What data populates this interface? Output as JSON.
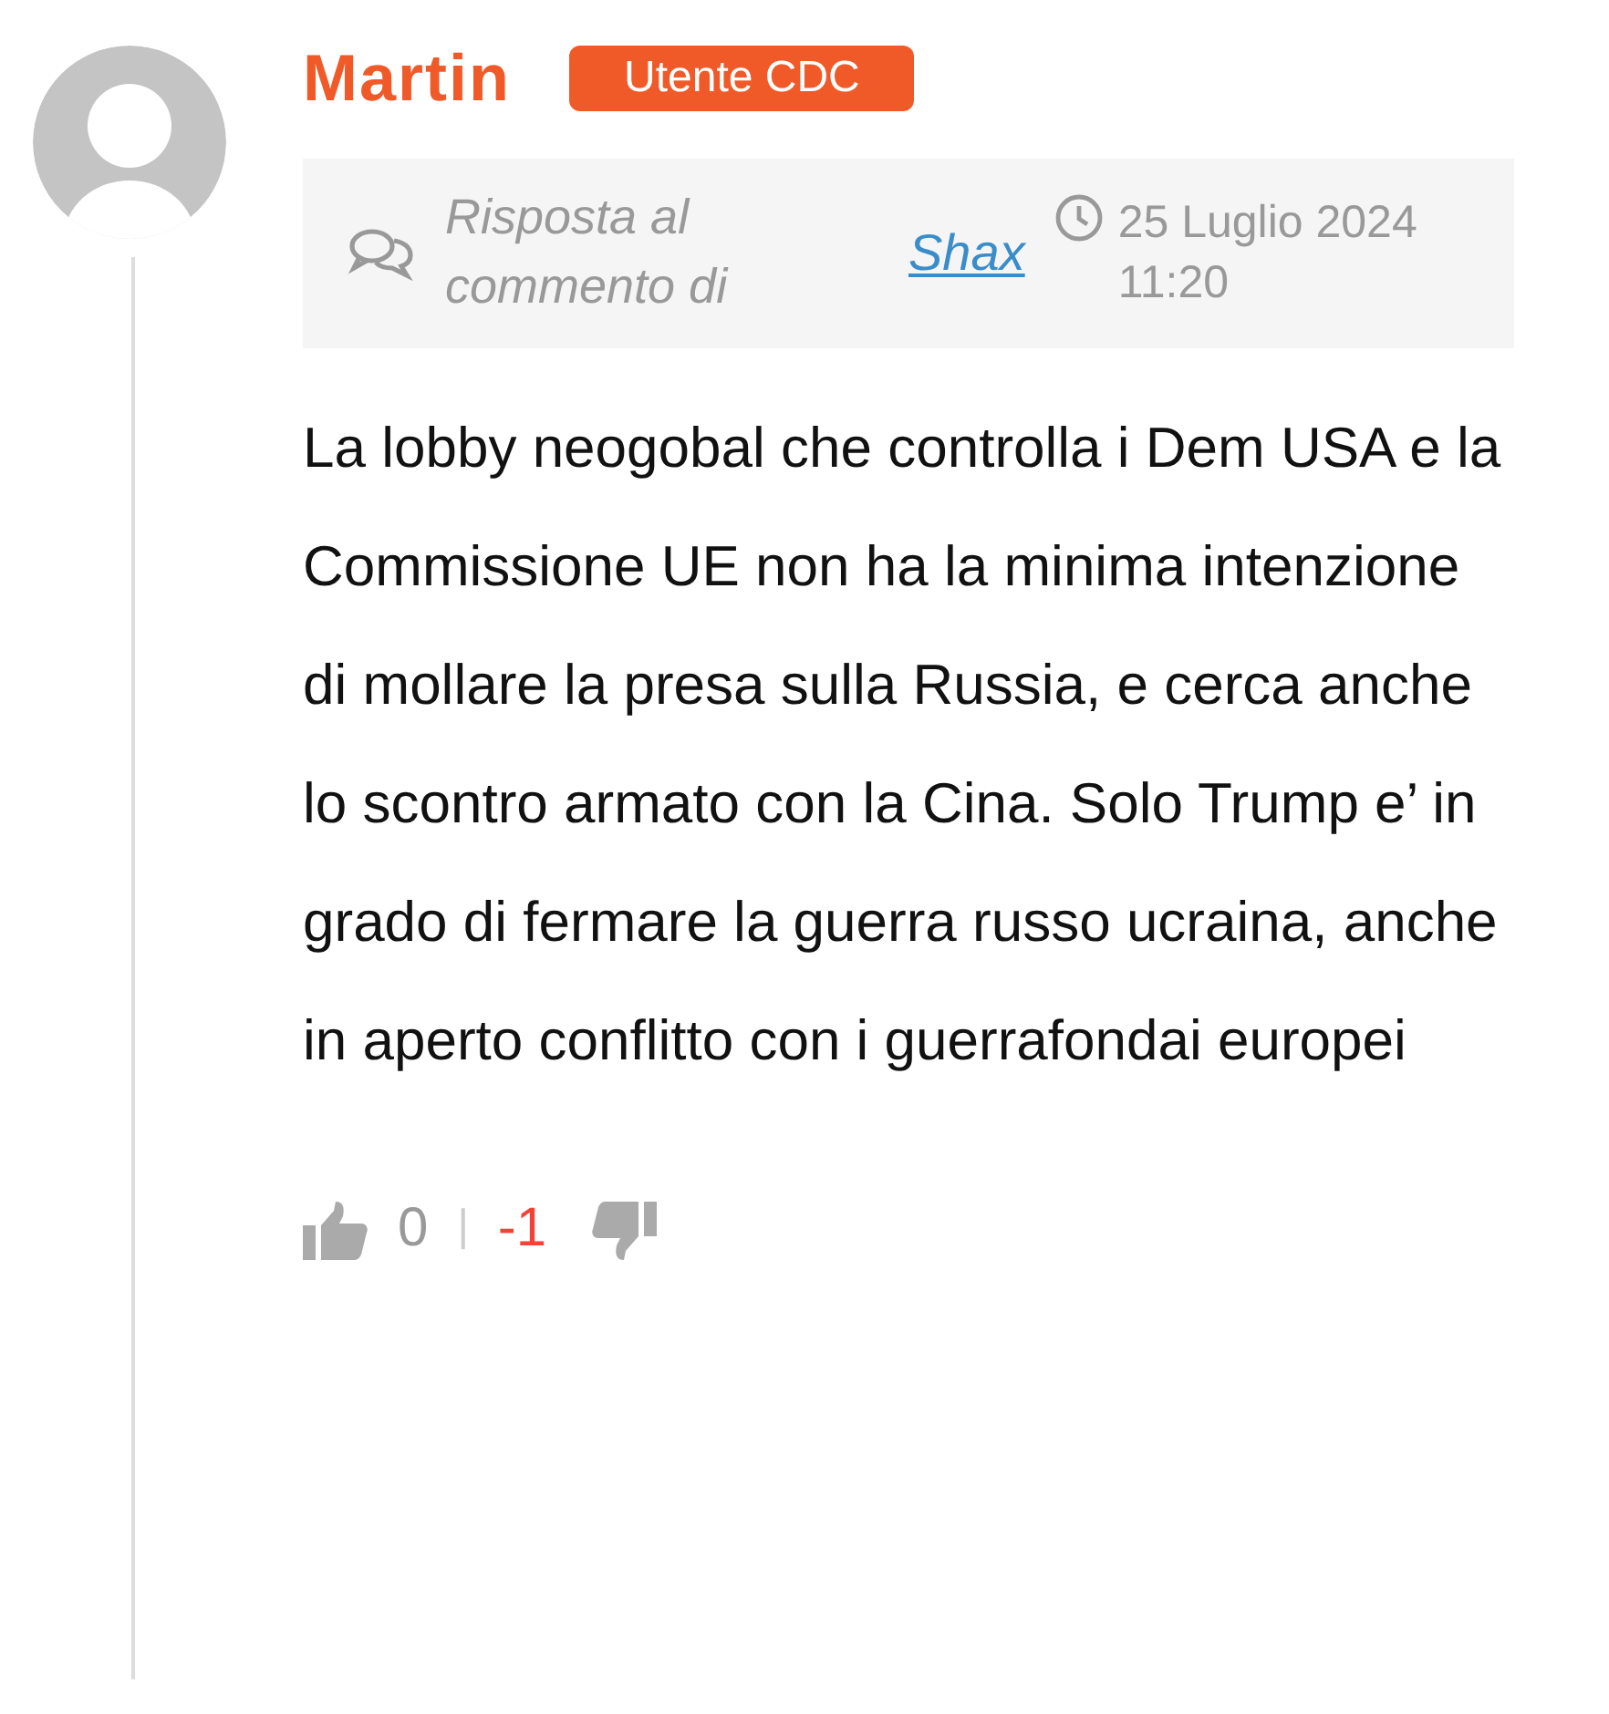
{
  "comment": {
    "author": "Martin",
    "badge": "Utente CDC",
    "reply": {
      "label": "Risposta al commento di",
      "to": "Shax"
    },
    "date": "25 Luglio 2024 11:20",
    "body": "La lobby neogobal che controlla i Dem USA e la Commissione UE non ha la minima intenzione di mollare la presa sulla Russia, e cerca anche lo scontro armato con la Cina. Solo Trump e’ in grado di fermare la guerra russo ucraina, anche in aperto conflitto con i guerrafondai europei",
    "votes": {
      "up": "0",
      "separator": "|",
      "down": "-1"
    }
  }
}
